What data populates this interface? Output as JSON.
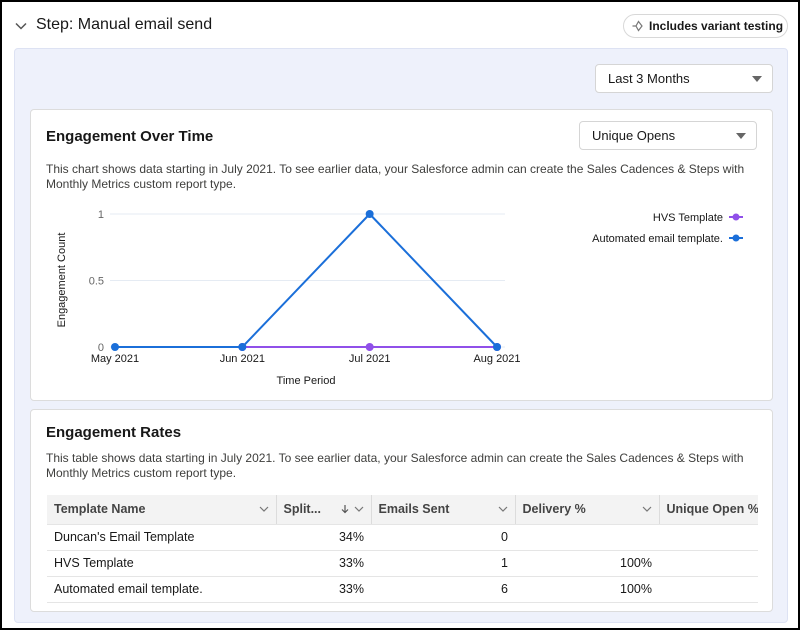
{
  "header": {
    "title": "Step: Manual email send",
    "badge_label": "Includes variant testing",
    "badge_icon": "variant-branch-icon"
  },
  "filters": {
    "date_range": "Last 3 Months",
    "metric": "Unique Opens"
  },
  "engagement_over_time": {
    "title": "Engagement Over Time",
    "description": "This chart shows data starting in July 2021. To see earlier data, your Salesforce admin can create the Sales Cadences & Steps with Monthly Metrics custom report type."
  },
  "chart_data": {
    "type": "line",
    "title": "Engagement Over Time",
    "xlabel": "Time Period",
    "ylabel": "Engagement Count",
    "categories": [
      "May 2021",
      "Jun 2021",
      "Jul 2021",
      "Aug 2021"
    ],
    "y_ticks": [
      "0",
      "0.5",
      "1"
    ],
    "ylim": [
      0,
      1
    ],
    "grid": true,
    "legend_position": "top-right",
    "series": [
      {
        "name": "HVS Template",
        "color": "#9050e9",
        "values": [
          null,
          0,
          0,
          0
        ]
      },
      {
        "name": "Automated email template.",
        "color": "#1b6fd9",
        "values": [
          0,
          0,
          1,
          0
        ]
      }
    ]
  },
  "engagement_rates": {
    "title": "Engagement Rates",
    "description": "This table shows data starting in July 2021. To see earlier data, your Salesforce admin can create the Sales Cadences & Steps with Monthly Metrics custom report type.",
    "columns": [
      {
        "label": "Template Name",
        "sorted": false
      },
      {
        "label": "Split...",
        "sorted": true,
        "sort_dir": "desc"
      },
      {
        "label": "Emails Sent",
        "sorted": false
      },
      {
        "label": "Delivery %",
        "sorted": false
      },
      {
        "label": "Unique Open %",
        "sorted": false
      }
    ],
    "rows": [
      {
        "template": "Duncan's Email Template",
        "split": "34%",
        "emails_sent": "0",
        "delivery": "",
        "unique_open": ""
      },
      {
        "template": "HVS Template",
        "split": "33%",
        "emails_sent": "1",
        "delivery": "100%",
        "unique_open": ""
      },
      {
        "template": "Automated email template.",
        "split": "33%",
        "emails_sent": "6",
        "delivery": "100%",
        "unique_open": ""
      }
    ]
  }
}
